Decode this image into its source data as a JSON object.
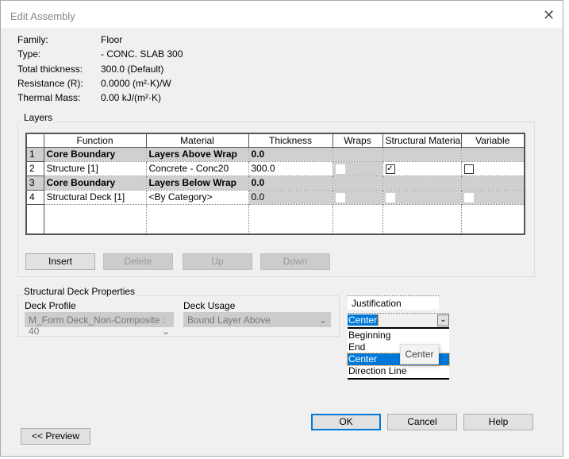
{
  "window": {
    "title": "Edit Assembly",
    "close_icon": "close-icon"
  },
  "props": [
    {
      "label": "Family:",
      "value": "Floor"
    },
    {
      "label": "Type:",
      "value": "- CONC. SLAB 300"
    },
    {
      "label": "Total thickness:",
      "value": "300.0 (Default)"
    },
    {
      "label": "Resistance (R):",
      "value": "0.0000 (m²·K)/W"
    },
    {
      "label": "Thermal Mass:",
      "value": "0.00 kJ/(m²·K)"
    }
  ],
  "layers": {
    "title": "Layers",
    "columns": [
      "",
      "Function",
      "Material",
      "Thickness",
      "Wraps",
      "Structural Material",
      "Variable"
    ],
    "rows": [
      {
        "num": "1",
        "function": "Core Boundary",
        "material": "Layers Above Wrap",
        "thickness": "0.0",
        "core": true
      },
      {
        "num": "2",
        "function": "Structure [1]",
        "material": "Concrete - Conc20",
        "thickness": "300.0",
        "wraps": false,
        "structural": true,
        "variable": false
      },
      {
        "num": "3",
        "function": "Core Boundary",
        "material": "Layers Below Wrap",
        "thickness": "0.0",
        "core": true
      },
      {
        "num": "4",
        "function": "Structural Deck [1]",
        "material": "<By Category>",
        "thickness": "0.0",
        "wraps": false,
        "structural": false,
        "variable": false
      }
    ],
    "buttons": {
      "insert": "Insert",
      "delete": "Delete",
      "up": "Up",
      "down": "Down"
    }
  },
  "deck": {
    "title": "Structural Deck Properties",
    "profile_label": "Deck Profile",
    "profile_value": "M_Form Deck_Non-Composite : 40",
    "usage_label": "Deck Usage",
    "usage_value": "Bound Layer Above"
  },
  "justification": {
    "label": "Justification",
    "value": "Center",
    "options": [
      "Beginning",
      "End",
      "Center",
      "Direction Line"
    ],
    "tooltip": "Center",
    "selected_color": "#0078d7"
  },
  "footer": {
    "ok": "OK",
    "cancel": "Cancel",
    "help": "Help",
    "preview": "<< Preview"
  }
}
